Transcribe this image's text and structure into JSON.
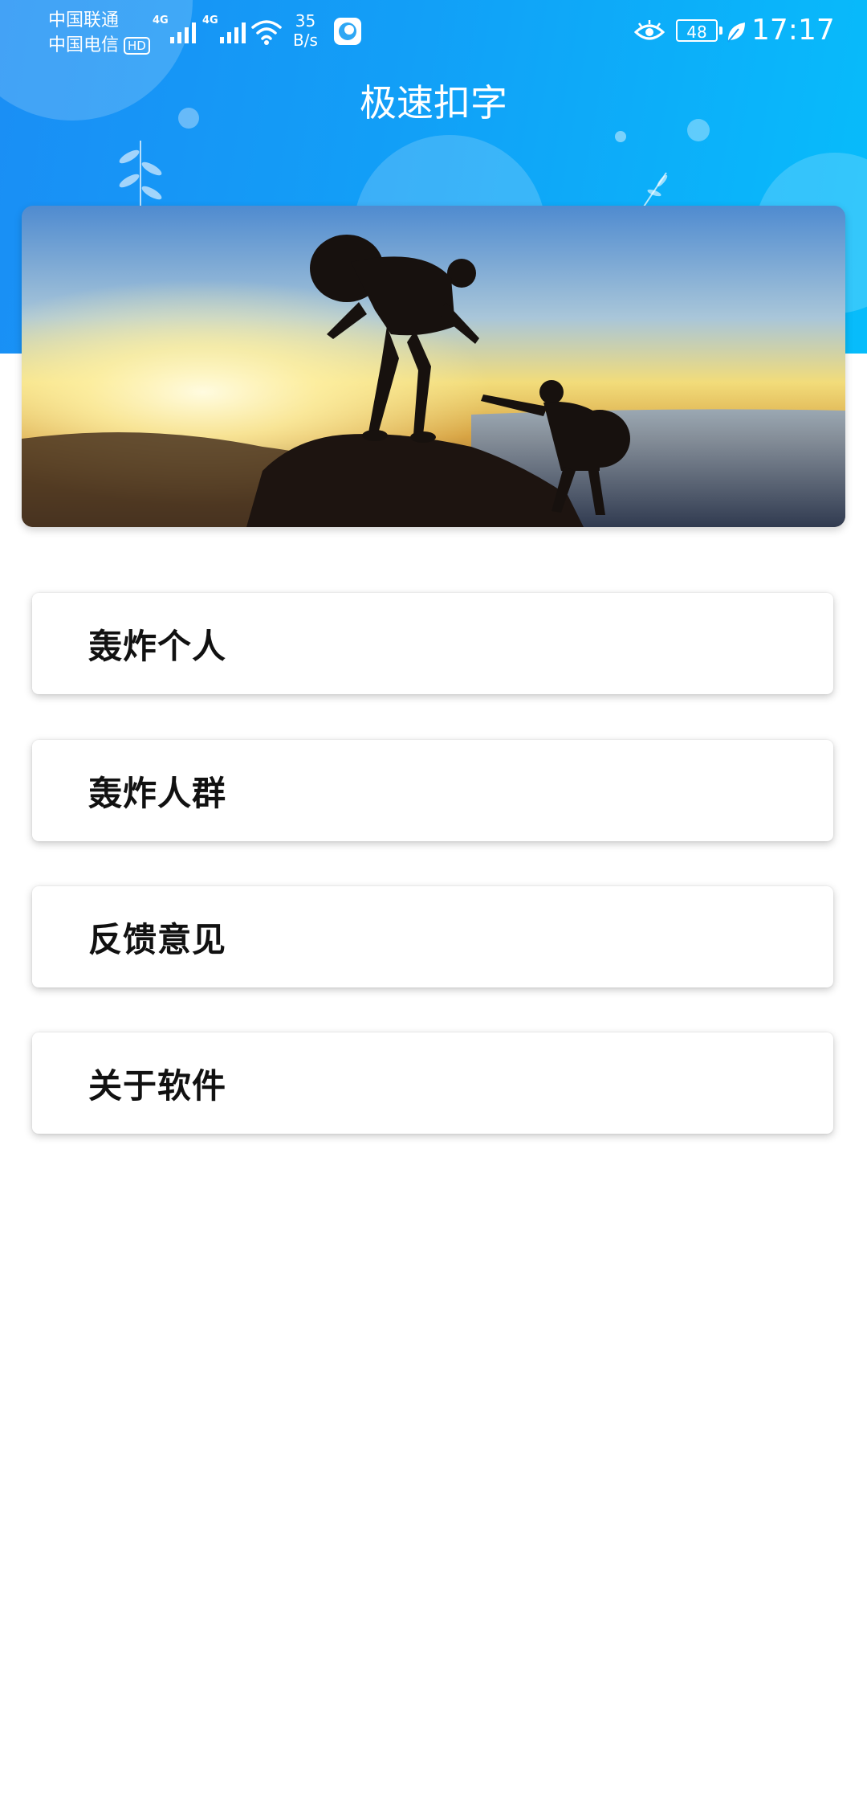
{
  "status_bar": {
    "carrier_1": "中国联通",
    "carrier_2": "中国电信",
    "hd_badge": "HD",
    "network_1": "4G",
    "network_2": "4G",
    "speed_value": "35",
    "speed_unit": "B/s",
    "battery_level": "48",
    "time": "17:17"
  },
  "header": {
    "title": "极速扣字",
    "background_colors": [
      "#1a8ef5",
      "#07bdfb"
    ]
  },
  "banner": {
    "image_description": "two hikers silhouetted at sunset, one helping the other up a rock"
  },
  "menu": {
    "items": [
      {
        "label": "轰炸个人"
      },
      {
        "label": "轰炸人群"
      },
      {
        "label": "反馈意见"
      },
      {
        "label": "关于软件"
      }
    ]
  }
}
